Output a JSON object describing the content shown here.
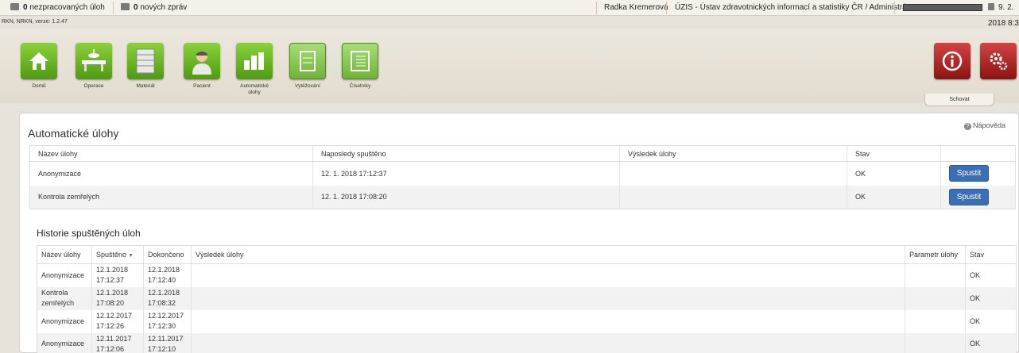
{
  "topbar": {
    "unprocessed_count": "0",
    "unprocessed_label": "nezpracovaných úloh",
    "messages_count": "0",
    "messages_label": "nových zpráv",
    "user": "Radka Kremerová",
    "organization": "ÚZIS - Ústav zdravotnických informací a statistiky ČR / Administrátor",
    "date": "9. 2. 2018 8:3"
  },
  "version": "RKN, NRKN, verze: 1.2.47",
  "toolbar": {
    "items": [
      {
        "label": "Domů",
        "icon": "home-icon"
      },
      {
        "label": "Operace",
        "icon": "operation-icon"
      },
      {
        "label": "Materiál",
        "icon": "material-icon"
      },
      {
        "label": "Pacient",
        "icon": "patient-icon"
      },
      {
        "label": "Automatické úlohy",
        "icon": "automatic-tasks-icon"
      },
      {
        "label": "Vytěžování",
        "icon": "extraction-icon"
      },
      {
        "label": "Číselníky",
        "icon": "codebooks-icon"
      }
    ],
    "hide_label": "Schovat"
  },
  "panel": {
    "title": "Automatické úlohy",
    "help_label": "Nápověda"
  },
  "tasks": {
    "headers": [
      "Název úlohy",
      "Naposledy spuštěno",
      "Výsledek úlohy",
      "Stav",
      ""
    ],
    "rows": [
      {
        "name": "Anonymizace",
        "last_run": "12. 1. 2018 17:12:37",
        "result": "",
        "status": "OK",
        "action": "Spustit"
      },
      {
        "name": "Kontrola zemřelých",
        "last_run": "12. 1. 2018 17:08:20",
        "result": "",
        "status": "OK",
        "action": "Spustit"
      }
    ]
  },
  "history": {
    "title": "Historie spuštěných úloh",
    "headers": [
      "Název úlohy",
      "Spuštěno",
      "Dokončeno",
      "Výsledek úlohy",
      "Parametr úlohy",
      "Stav"
    ],
    "sort_indicator": "▼",
    "rows": [
      {
        "name": "Anonymizace",
        "started_date": "12.1.2018",
        "started_time": "17:12:37",
        "finished_date": "12.1.2018",
        "finished_time": "17:12:40",
        "result": "",
        "param": "",
        "status": "OK"
      },
      {
        "name": "Kontrola zemřelých",
        "started_date": "12.1.2018",
        "started_time": "17:08:20",
        "finished_date": "12.1.2018",
        "finished_time": "17:08:32",
        "result": "",
        "param": "",
        "status": "OK"
      },
      {
        "name": "Anonymizace",
        "started_date": "12.12.2017",
        "started_time": "17:12:26",
        "finished_date": "12.12.2017",
        "finished_time": "17:12:30",
        "result": "",
        "param": "",
        "status": "OK"
      },
      {
        "name": "Anonymizace",
        "started_date": "12.11.2017",
        "started_time": "17:12:06",
        "finished_date": "12.11.2017",
        "finished_time": "17:12:10",
        "result": "",
        "param": "",
        "status": "OK"
      }
    ]
  },
  "colors": {
    "accent": "#3a6fb5",
    "tile_green": "#5aa21c",
    "tile_red": "#a31a1a"
  }
}
